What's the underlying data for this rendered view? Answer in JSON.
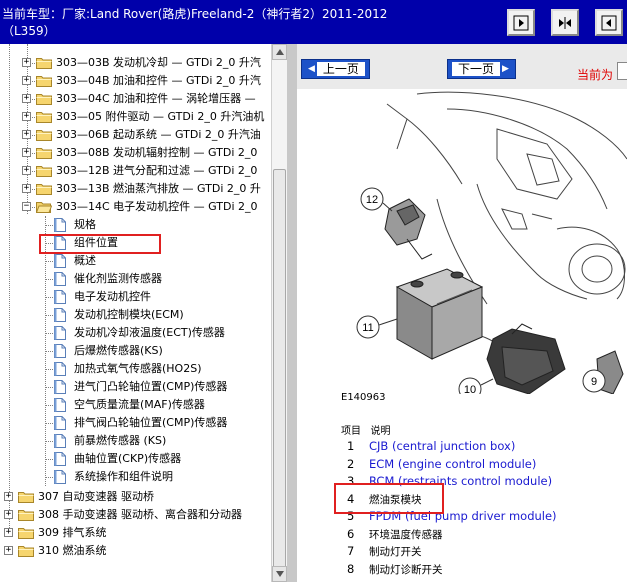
{
  "header": {
    "title": "当前车型：厂家:Land Rover(路虎)Freeland-2（神行者2）2011-2012（L359）"
  },
  "tree": {
    "items": [
      {
        "label": "303—03B 发动机冷却 — GTDi 2_0 升汽",
        "type": "folder",
        "expander": "+"
      },
      {
        "label": "303—04B 加油和控件 — GTDi 2_0 升汽",
        "type": "folder",
        "expander": "+"
      },
      {
        "label": "303—04C 加油和控件 — 涡轮增压器 —",
        "type": "folder",
        "expander": "+"
      },
      {
        "label": "303—05 附件驱动 — GTDi 2_0 升汽油机",
        "type": "folder",
        "expander": "+"
      },
      {
        "label": "303—06B 起动系统 — GTDi 2_0 升汽油",
        "type": "folder",
        "expander": "+"
      },
      {
        "label": "303—08B 发动机辐射控制 — GTDi 2_0",
        "type": "folder",
        "expander": "+"
      },
      {
        "label": "303—12B 进气分配和过滤 — GTDi 2_0",
        "type": "folder",
        "expander": "+"
      },
      {
        "label": "303—13B 燃油蒸汽排放 — GTDi 2_0 升",
        "type": "folder",
        "expander": "+"
      },
      {
        "label": "303—14C 电子发动机控件 — GTDi 2_0",
        "type": "folder-open",
        "expander": "−"
      }
    ],
    "children": [
      "规格",
      "组件位置",
      "概述",
      "催化剂监测传感器",
      "电子发动机控件",
      "发动机控制模块(ECM)",
      "发动机冷却液温度(ECT)传感器",
      "后爆燃传感器(KS)",
      "加热式氧气传感器(HO2S)",
      "进气门凸轮轴位置(CMP)传感器",
      "空气质量流量(MAF)传感器",
      "排气阀凸轮轴位置(CMP)传感器",
      "前暴燃传感器 (KS)",
      "曲轴位置(CKP)传感器",
      "系统操作和组件说明"
    ],
    "bottom_items": [
      "307 自动变速器 驱动桥",
      "308 手动变速器 驱动桥、离合器和分动器",
      "309 排气系统",
      "310 燃油系统"
    ]
  },
  "nav": {
    "prev_label": "上一页",
    "next_label": "下一页",
    "current_label": "当前为"
  },
  "diagram": {
    "id": "E140963",
    "callouts": [
      "12",
      "11",
      "10",
      "9"
    ]
  },
  "legend": {
    "header_item": "项目",
    "header_desc": "说明",
    "rows": [
      {
        "num": "1",
        "text": "CJB (central junction box)",
        "link": true
      },
      {
        "num": "2",
        "text": "ECM (engine control module)",
        "link": true
      },
      {
        "num": "3",
        "text": "RCM (restraints control module)",
        "link": true
      },
      {
        "num": "4",
        "text": "燃油泵模块",
        "link": false
      },
      {
        "num": "5",
        "text": "FPDM (fuel pump driver module)",
        "link": true
      },
      {
        "num": "6",
        "text": "环境温度传感器",
        "link": false
      },
      {
        "num": "7",
        "text": "制动灯开关",
        "link": false
      },
      {
        "num": "8",
        "text": "制动灯诊断开关",
        "link": false
      }
    ]
  }
}
